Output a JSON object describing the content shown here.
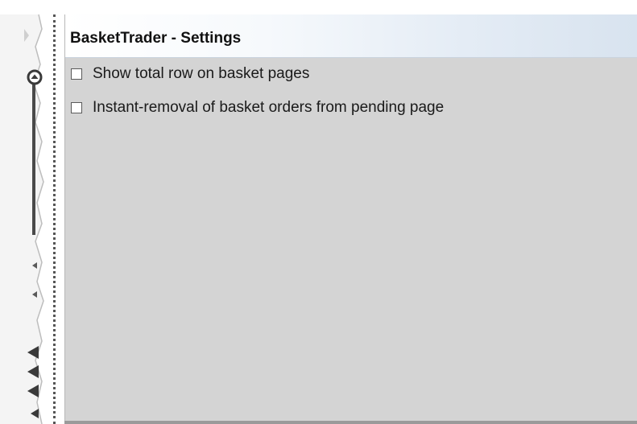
{
  "window": {
    "title": "BasketTrader - Settings"
  },
  "settings": {
    "options": [
      {
        "label": "Show total row on basket pages",
        "checked": false
      },
      {
        "label": "Instant-removal of basket orders from pending page",
        "checked": false
      }
    ]
  },
  "icons": {
    "collapse": "chevron-up-icon",
    "side_tab": "arrow-left-icon"
  },
  "colors": {
    "panel_background": "#d4d4d4",
    "header_gradient_start": "#ffffff",
    "header_gradient_end": "#d8e3ef",
    "text": "#1a1a1a"
  }
}
